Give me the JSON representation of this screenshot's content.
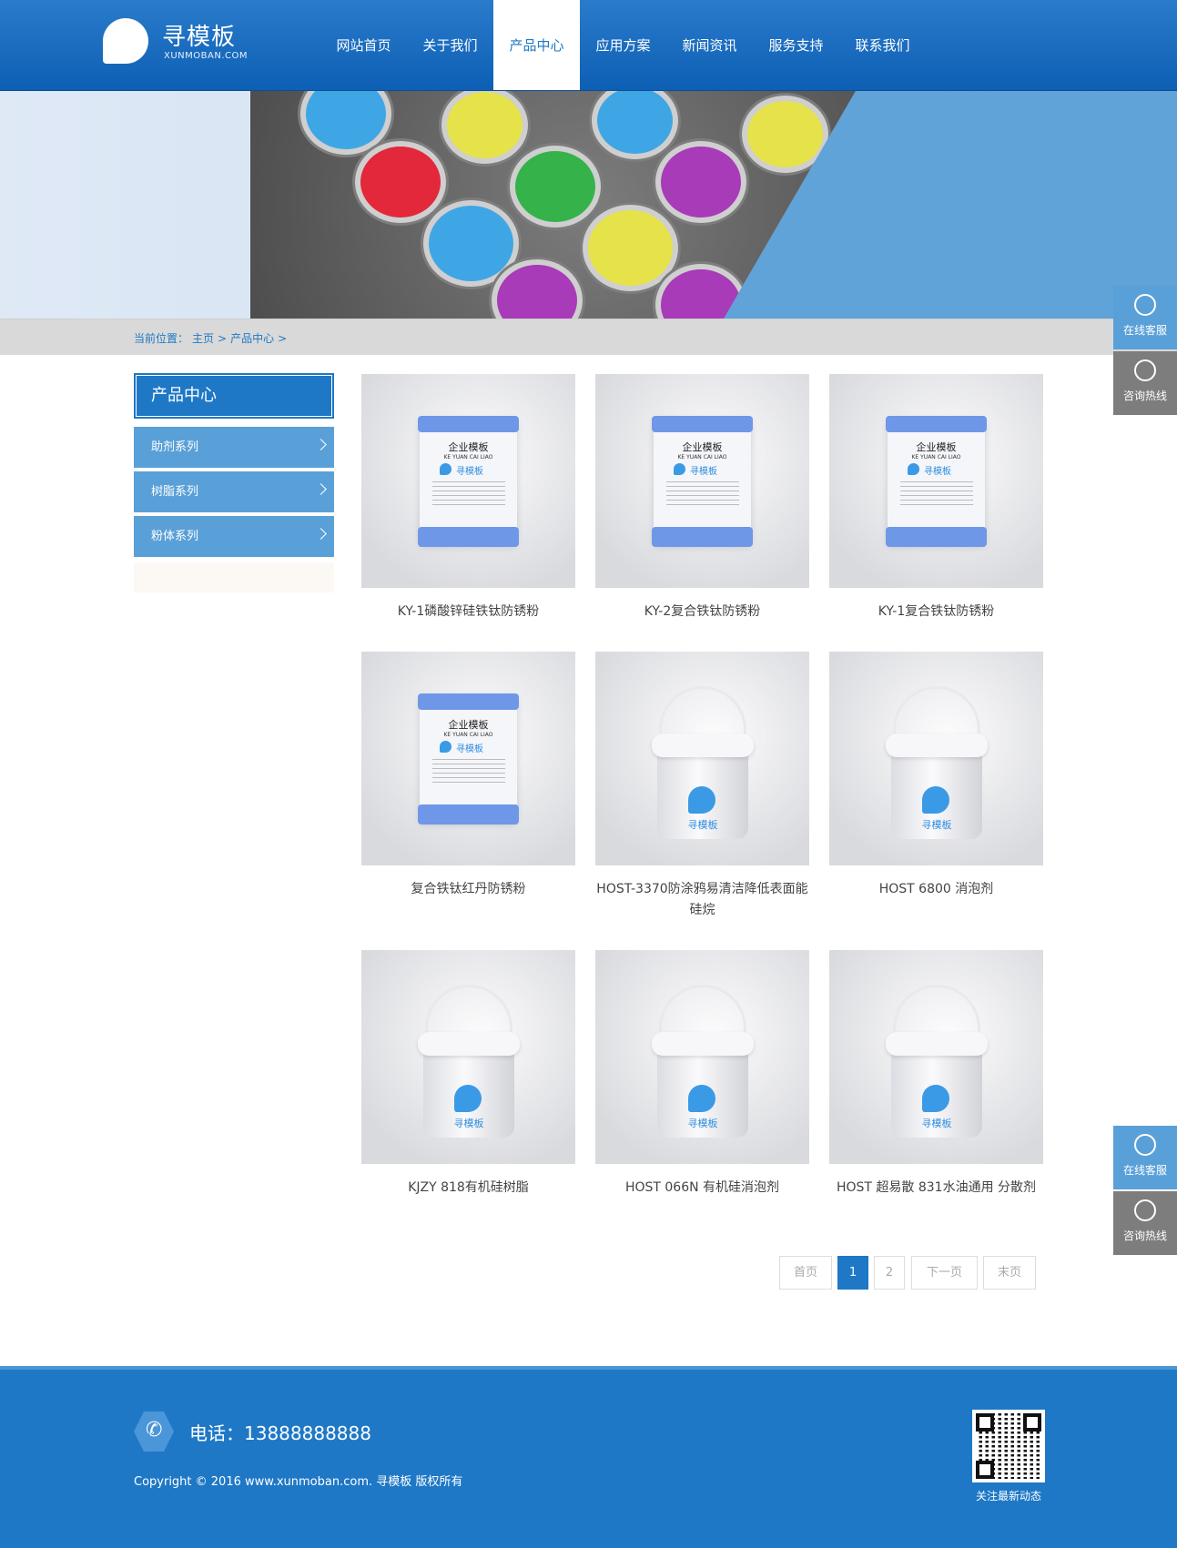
{
  "header": {
    "logo_title": "寻模板",
    "logo_sub": "XUNMOBAN.COM",
    "nav": [
      {
        "label": "网站首页",
        "active": false
      },
      {
        "label": "关于我们",
        "active": false
      },
      {
        "label": "产品中心",
        "active": true
      },
      {
        "label": "应用方案",
        "active": false
      },
      {
        "label": "新闻资讯",
        "active": false
      },
      {
        "label": "服务支持",
        "active": false
      },
      {
        "label": "联系我们",
        "active": false
      }
    ]
  },
  "breadcrumb": {
    "prefix": "当前位置：",
    "home": "主页",
    "sep": ">",
    "current": "产品中心"
  },
  "sidebar": {
    "title": "产品中心",
    "items": [
      {
        "label": "助剂系列"
      },
      {
        "label": "树脂系列"
      },
      {
        "label": "粉体系列"
      }
    ]
  },
  "products": [
    {
      "name": "KY-1磷酸锌硅铁钛防锈粉",
      "type": "bag"
    },
    {
      "name": "KY-2复合铁钛防锈粉",
      "type": "bag"
    },
    {
      "name": "KY-1复合铁钛防锈粉",
      "type": "bag"
    },
    {
      "name": "复合铁钛红丹防锈粉",
      "type": "bag"
    },
    {
      "name": "HOST-3370防涂鸦易清洁降低表面能硅烷",
      "type": "bucket"
    },
    {
      "name": "HOST 6800 消泡剂",
      "type": "bucket"
    },
    {
      "name": "KJZY 818有机硅树脂",
      "type": "bucket"
    },
    {
      "name": "HOST 066N 有机硅消泡剂",
      "type": "bucket"
    },
    {
      "name": "HOST 超易散 831水油通用 分散剂",
      "type": "bucket"
    }
  ],
  "product_image_text": {
    "bag_title": "企业模板",
    "bag_sub": "KE YUAN CAI LIAO",
    "brand": "寻模板"
  },
  "pagination": {
    "first": "首页",
    "pages": [
      "1",
      "2"
    ],
    "current": "1",
    "next": "下一页",
    "last": "末页"
  },
  "float_buttons": [
    {
      "label": "在线客服",
      "icon": "customer-service-icon"
    },
    {
      "label": "咨询热线",
      "icon": "phone-icon"
    },
    {
      "label": "在线客服",
      "icon": "customer-service-icon"
    },
    {
      "label": "咨询热线",
      "icon": "phone-icon"
    }
  ],
  "footer": {
    "phone": "电话：13888888888",
    "copyright": "Copyright © 2016 www.xunmoban.com. 寻模板 版权所有",
    "qr_label": "关注最新动态"
  },
  "colors": {
    "brand_blue": "#1e78c6",
    "sidebar_blue": "#5aa0d8",
    "float_gray": "#7d7d7d"
  }
}
